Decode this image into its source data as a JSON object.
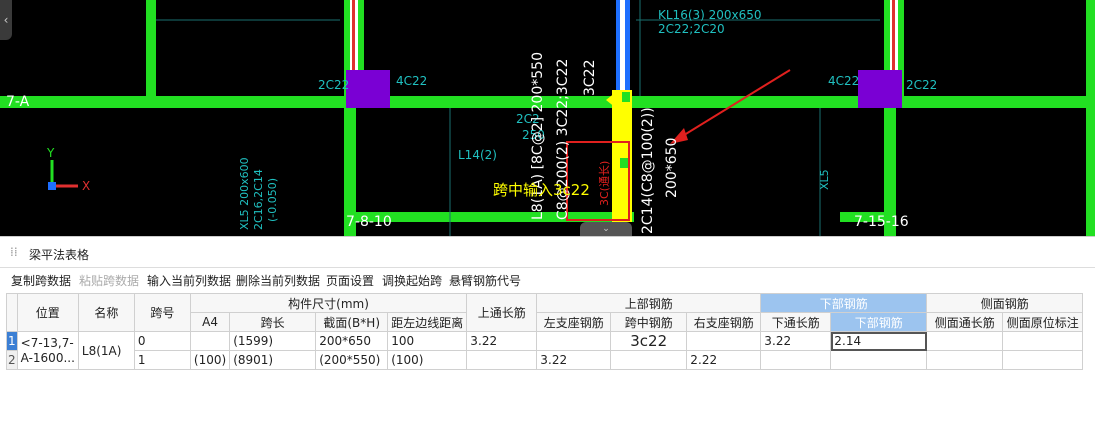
{
  "cad": {
    "axis_labels": [
      "7-A",
      "7-8-10",
      "7-15-16"
    ],
    "rebar_labels": {
      "left_2c22": "2C22",
      "left_4c22": "4C22",
      "right_4c22": "4C22",
      "right_2c22": "2C22",
      "kl16_line1": "KL16(3) 200x650",
      "kl16_line2": "2C22;2C20",
      "l14": "L14(2)",
      "left_2c2": "2C2",
      "left_250": "250",
      "xl5": "XL5",
      "vert_a": "L8(1A) [8C@2] 200*550",
      "vert_b": "C8@200(2) 3C22;3C22",
      "vert_c": "3C22",
      "vert_d": "2C14(C8@100(2))",
      "vert_e": "200*650",
      "vert_f": "3C(通长)",
      "side_a": "XL5 200x600",
      "side_b": "2C16,2C14",
      "side_c": "(-0.050)"
    },
    "annotation": "跨中输入3c22",
    "axes": {
      "y": "Y",
      "x": "X"
    },
    "colors": {
      "beam": "#22e022",
      "column": "#7a00d4",
      "highlight": "#ffff00",
      "annotation_box": "#e0201e",
      "label": "#20c0c0"
    }
  },
  "panel": {
    "title": "梁平法表格",
    "toolbar": [
      "复制跨数据",
      "粘贴跨数据",
      "输入当前列数据",
      "删除当前列数据",
      "页面设置",
      "调换起始跨",
      "悬臂钢筋代号"
    ],
    "headers": {
      "position": "位置",
      "name": "名称",
      "span_no": "跨号",
      "size_group": "构件尺寸(mm)",
      "a4": "A4",
      "span_len": "跨长",
      "section": "截面(B*H)",
      "left_edge": "距左边线距离",
      "top_through": "上通长筋",
      "top_group": "上部钢筋",
      "left_support": "左支座钢筋",
      "mid_span": "跨中钢筋",
      "right_support": "右支座钢筋",
      "bottom_group": "下部钢筋",
      "bottom_through": "下通长筋",
      "bottom_rebar": "下部钢筋",
      "side_group": "侧面钢筋",
      "side_through": "侧面通长筋",
      "side_original": "侧面原位标注"
    },
    "row1": {
      "num": "1",
      "position_l1": "<7-13,7-",
      "position_l2": "A-1600...",
      "name": "L8(1A)",
      "span_no": "0",
      "a4": "",
      "span_len": "(1599)",
      "section": "200*650",
      "left_edge": "100",
      "top_through": "3․22",
      "left_support": "",
      "mid_span": "3c22",
      "right_support": "",
      "bottom_through": "3․22",
      "bottom_rebar": "2․14",
      "side_through": "",
      "side_original": ""
    },
    "row2": {
      "num": "2",
      "span_no": "1",
      "a4": "(100)",
      "span_len": "(8901)",
      "section": "(200*550)",
      "left_edge": "(100)",
      "top_through": "",
      "left_support": "3․22",
      "mid_span": "",
      "right_support": "2․22",
      "bottom_through": "",
      "bottom_rebar": "",
      "side_through": "",
      "side_original": ""
    }
  }
}
